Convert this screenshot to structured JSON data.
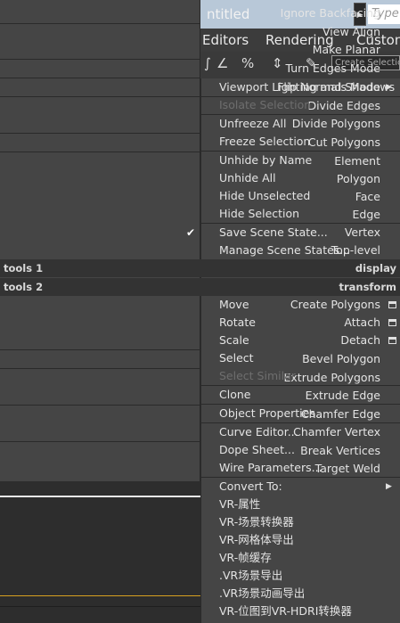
{
  "app": {
    "title_fragment": "ntitled",
    "search_placeholder": "Type",
    "menubar": [
      "Editors",
      "Rendering",
      "Custon"
    ],
    "selection_set_placeholder": "Create Selectio"
  },
  "quad_left_top": [
    {
      "label": "Ignore Backfacing"
    },
    {
      "label": "View Align"
    },
    {
      "label": "Make Planar"
    },
    {
      "label": "Turn Edges Mode"
    },
    {
      "label": "Flip Normals Mode"
    },
    {
      "label": "Divide Edges"
    },
    {
      "label": "Divide Polygons"
    },
    {
      "label": "Cut Polygons"
    },
    {
      "label": "Element"
    },
    {
      "label": "Polygon"
    },
    {
      "label": "Face"
    },
    {
      "label": "Edge"
    },
    {
      "label": "Vertex",
      "checked": true
    },
    {
      "label": "Top-level"
    }
  ],
  "quad_right_top": [
    {
      "label": "Viewport Lighting and Shadows",
      "submenu": true
    },
    {
      "label": "Isolate Selection",
      "disabled": true
    },
    {
      "label": "Unfreeze All"
    },
    {
      "label": "Freeze Selection"
    },
    {
      "label": "Unhide by Name"
    },
    {
      "label": "Unhide All"
    },
    {
      "label": "Hide Unselected"
    },
    {
      "label": "Hide Selection"
    },
    {
      "label": "Save Scene State..."
    },
    {
      "label": "Manage Scene States..."
    }
  ],
  "headers": {
    "tools1": "tools 1",
    "display": "display",
    "tools2": "tools 2",
    "transform": "transform"
  },
  "quad_left_bottom": [
    {
      "label": "Create Polygons"
    },
    {
      "label": "Attach"
    },
    {
      "label": "Detach"
    },
    {
      "label": "Bevel Polygon"
    },
    {
      "label": "Extrude Polygons"
    },
    {
      "label": "Extrude Edge"
    },
    {
      "label": "Chamfer Edge"
    },
    {
      "label": "Chamfer Vertex"
    },
    {
      "label": "Break Vertices"
    },
    {
      "label": "Target Weld"
    }
  ],
  "quad_right_bottom": [
    {
      "label": "Move",
      "box": true
    },
    {
      "label": "Rotate",
      "box": true
    },
    {
      "label": "Scale",
      "box": true
    },
    {
      "label": "Select"
    },
    {
      "label": "Select Similar",
      "disabled": true
    },
    {
      "label": "Clone"
    },
    {
      "label": "Object Properties..."
    },
    {
      "label": "Curve Editor..."
    },
    {
      "label": "Dope Sheet..."
    },
    {
      "label": "Wire Parameters..."
    },
    {
      "label": "Convert To:",
      "submenu": true
    },
    {
      "label": "VR-属性"
    },
    {
      "label": "VR-场景转换器"
    },
    {
      "label": "VR-网格体导出"
    },
    {
      "label": "VR-帧缓存"
    },
    {
      "label": ".VR场景导出"
    },
    {
      "label": ".VR场景动画导出"
    },
    {
      "label": "VR-位图到VR-HDRI转换器"
    }
  ]
}
